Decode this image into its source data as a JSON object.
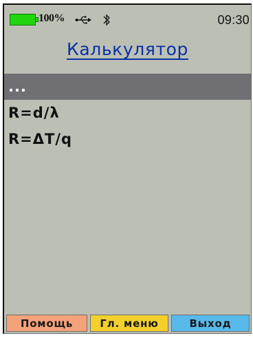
{
  "status_bar": {
    "battery_percent": "100%",
    "battery_level": 1.0,
    "usb_icon": "usb-icon",
    "bluetooth_icon": "bluetooth-icon",
    "time": "09:30"
  },
  "header": {
    "title": "Калькулятор"
  },
  "menu": {
    "items": [
      {
        "label": "...",
        "selected": true
      },
      {
        "label": "R=d/λ",
        "selected": false
      },
      {
        "label": "R=ΔT/q",
        "selected": false
      }
    ]
  },
  "softkeys": {
    "help": "Помощь",
    "main_menu": "Гл. меню",
    "exit": "Выход"
  },
  "colors": {
    "screen_bg": "#bcc0b4",
    "title": "#0a2fa8",
    "selection": "#6f6f74",
    "battery": "#21d40f",
    "softkey_help": "#f4a27a",
    "softkey_menu": "#f3d02a",
    "softkey_exit": "#58b9ea"
  }
}
